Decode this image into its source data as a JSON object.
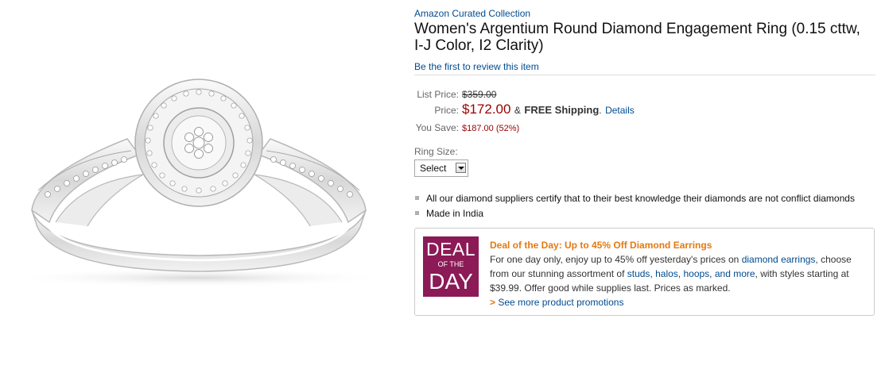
{
  "product": {
    "brand": "Amazon Curated Collection",
    "title": "Women's Argentium Round Diamond Engagement Ring (0.15 cttw, I-J Color, I2 Clarity)",
    "review_link": "Be the first to review this item",
    "image_alt": "Silver diamond engagement ring"
  },
  "pricing": {
    "list_label": "List Price:",
    "list_value": "$359.00",
    "price_label": "Price:",
    "price_value": "$172.00",
    "price_sep": "&",
    "free_shipping": "FREE Shipping",
    "period": ".",
    "details_link": "Details",
    "save_label": "You Save:",
    "save_value": "$187.00 (52%)"
  },
  "size": {
    "label": "Ring Size:",
    "selected": "Select"
  },
  "bullets": [
    "All our diamond suppliers certify that to their best knowledge their diamonds are not conflict diamonds",
    "Made in India"
  ],
  "promo": {
    "badge_line1": "DEAL",
    "badge_line2": "OF THE",
    "badge_line3": "DAY",
    "title": "Deal of the Day: Up to 45% Off Diamond Earrings",
    "text1": "For one day only, enjoy up to 45% off yesterday's prices on ",
    "link1": "diamond earrings",
    "text2": ", choose from our stunning assortment of ",
    "link2": "studs",
    "sep1": ", ",
    "link3": "halos",
    "sep2": ", ",
    "link4": "hoops",
    "sep3": ", ",
    "link5": "and more",
    "text3": ", with styles starting at $39.99. Offer good while supplies last. Prices as marked.",
    "more_arrow": ">",
    "more_link": "See more product promotions"
  },
  "colors": {
    "link": "#004b91",
    "price": "#990000",
    "promo_title": "#e47911",
    "badge": "#8b1a56"
  }
}
